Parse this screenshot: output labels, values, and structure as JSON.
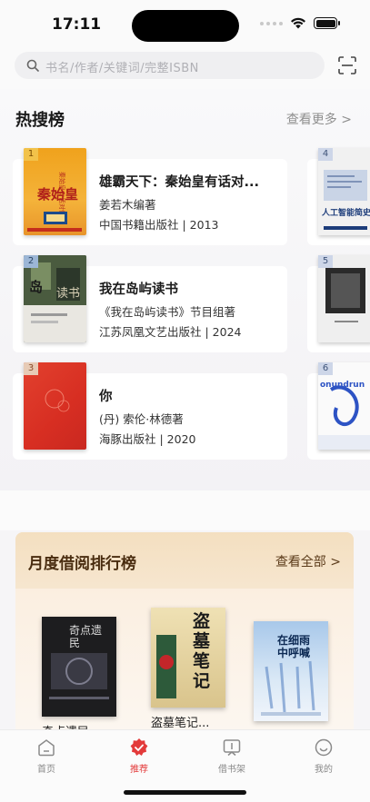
{
  "status_bar": {
    "time": "17:11"
  },
  "search": {
    "placeholder": "书名/作者/关键词/完整ISBN"
  },
  "hot_list": {
    "title": "热搜榜",
    "more_label": "查看更多 >",
    "books": [
      {
        "rank": "1",
        "title": "雄霸天下：秦始皇有话对...",
        "author": "姜若木编著",
        "publisher": "中国书籍出版社 | 2013"
      },
      {
        "rank": "2",
        "title": "我在岛屿读书",
        "author": "《我在岛屿读书》节目组著",
        "publisher": "江苏凤凰文艺出版社 | 2024"
      },
      {
        "rank": "3",
        "title": "你",
        "author": "(丹) 索伦·林德著",
        "publisher": "海豚出版社 | 2020"
      }
    ],
    "side_ranks": [
      "4",
      "5",
      "6"
    ],
    "cover_text": {
      "book1_line": "秦始皇",
      "side4": "人工智能简史",
      "side6": "onundrun"
    }
  },
  "monthly": {
    "title": "月度借阅排行榜",
    "all_label": "查看全部 >",
    "books": [
      {
        "title": "奇点遗民",
        "cover_text": "奇点遗民"
      },
      {
        "title": "盗墓笔记...",
        "cover_text": "盗墓笔记"
      },
      {
        "title": "",
        "cover_text": "在细雨中呼喊"
      }
    ]
  },
  "tabbar": {
    "tabs": [
      {
        "label": "首页",
        "icon": "home-icon"
      },
      {
        "label": "推荐",
        "icon": "recommend-icon"
      },
      {
        "label": "借书架",
        "icon": "bookshelf-icon"
      },
      {
        "label": "我的",
        "icon": "profile-icon"
      }
    ],
    "active_color": "#e33a3a"
  }
}
